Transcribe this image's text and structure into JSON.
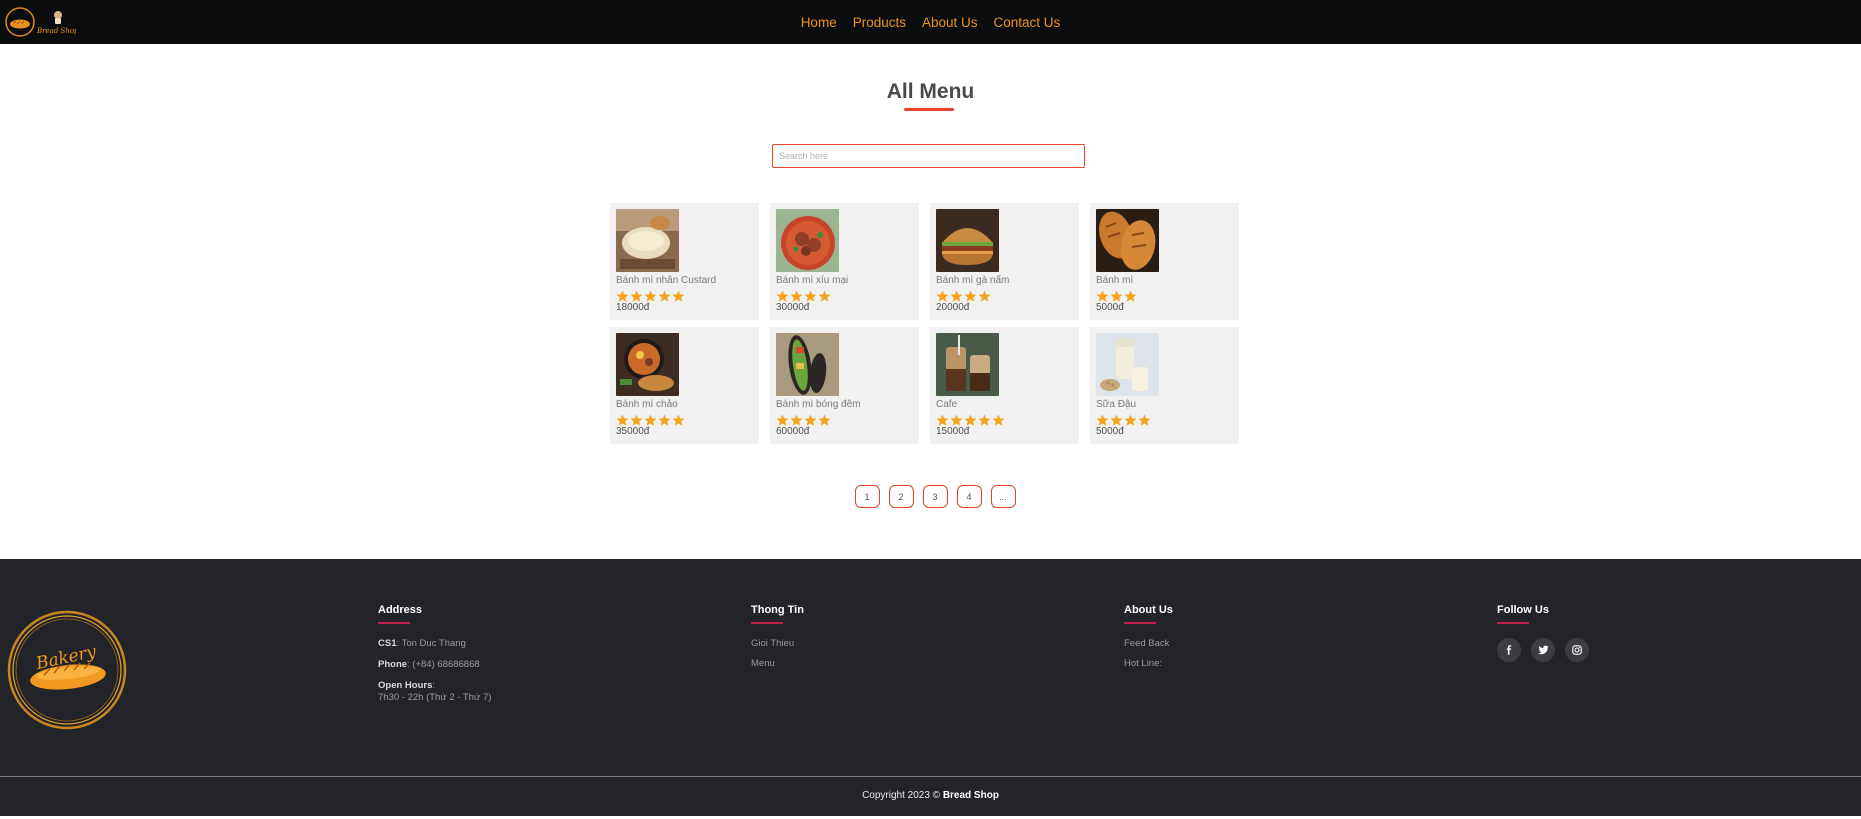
{
  "header": {
    "brand": "Bread Shop",
    "nav": [
      {
        "label": "Home"
      },
      {
        "label": "Products"
      },
      {
        "label": "About Us"
      },
      {
        "label": "Contact Us"
      }
    ],
    "colors": {
      "bar": "#0b0c0d",
      "link": "#f0921a"
    }
  },
  "main": {
    "title": "All Menu",
    "search": {
      "placeholder": "Search here",
      "value": ""
    },
    "products": [
      {
        "name": "Bánh mì nhân Custard",
        "stars": 5,
        "price": "18000đ",
        "image": "custard-bread-photo"
      },
      {
        "name": "Bánh mì xíu mại",
        "stars": 4,
        "price": "30000đ",
        "image": "meatball-soup-photo"
      },
      {
        "name": "Bánh mì gà nấm",
        "stars": 4,
        "price": "20000đ",
        "image": "chicken-mushroom-burger-photo"
      },
      {
        "name": "Bánh mì",
        "stars": 3,
        "price": "5000đ",
        "image": "baguette-photo"
      },
      {
        "name": "Bánh mì chảo",
        "stars": 5,
        "price": "35000đ",
        "image": "pan-bread-photo"
      },
      {
        "name": "Bánh mì bóng đêm",
        "stars": 4,
        "price": "60000đ",
        "image": "black-bread-sandwich-photo"
      },
      {
        "name": "Cafe",
        "stars": 5,
        "price": "15000đ",
        "image": "iced-coffee-photo"
      },
      {
        "name": "Sữa Đậu",
        "stars": 4,
        "price": "5000đ",
        "image": "soy-milk-photo"
      }
    ],
    "pagination": [
      "1",
      "2",
      "3",
      "4",
      "..."
    ],
    "colors": {
      "accent": "#e8412c",
      "star": "#f5a31a",
      "card": "#f1f1f1"
    }
  },
  "footer": {
    "logo_text": "Bakery",
    "address": {
      "title": "Address",
      "cs1_label": "CS1",
      "cs1_value": ": Ton Duc Thang",
      "phone_label": "Phone",
      "phone_value": ": (+84) 68686868",
      "hours_label": "Open Hours",
      "hours_colon": ":",
      "hours_value": "7h30 - 22h (Thứ 2 - Thứ 7)"
    },
    "info": {
      "title": "Thong Tin",
      "links": [
        "Gioi Thieu",
        "Menu"
      ]
    },
    "about": {
      "title": "About Us",
      "links": [
        "Feed Back",
        "Hot Line:"
      ]
    },
    "follow": {
      "title": "Follow Us",
      "icons": [
        "facebook-icon",
        "twitter-icon",
        "instagram-icon"
      ]
    },
    "copyright_prefix": "Copyright 2023 © ",
    "copyright_brand": "Bread Shop",
    "colors": {
      "background": "#23242a",
      "underline": "#c0214a"
    }
  }
}
